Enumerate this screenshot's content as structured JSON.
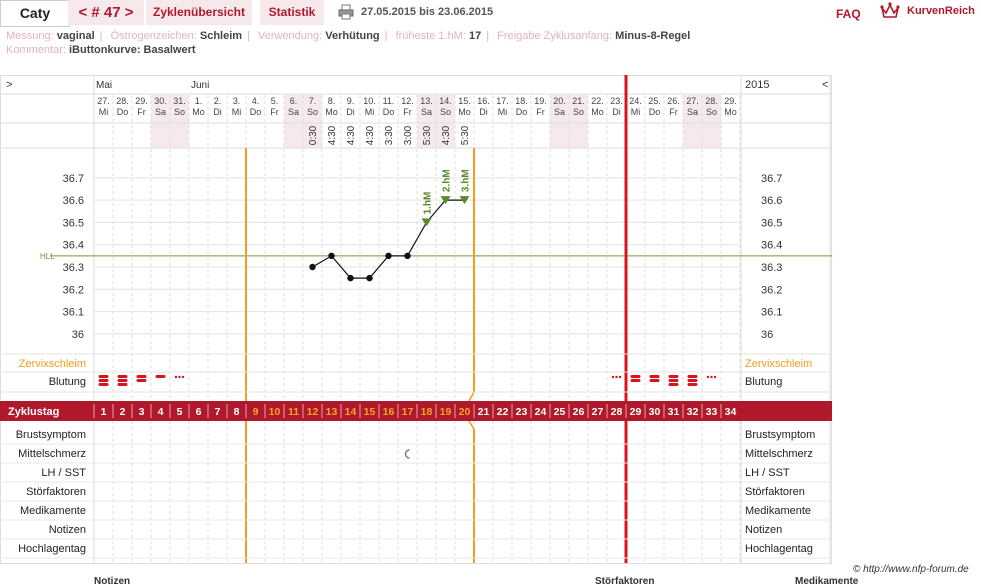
{
  "header": {
    "user_name": "Caty",
    "cycle_nav_label": "< # 47 >",
    "tabs": [
      {
        "label": "Zyklenübersicht"
      },
      {
        "label": "Statistik"
      }
    ],
    "print_icon": "printer-icon",
    "date_range": "27.05.2015 bis 23.06.2015",
    "faq_label": "FAQ",
    "brand_icon": "crown-icon",
    "brand_name": "KurvenReich"
  },
  "info": {
    "messung_label": "Messung:",
    "messung_value": "vaginal",
    "oestrogen_label": "Östrogenzeichen:",
    "oestrogen_value": "Schleim",
    "verwendung_label": "Verwendung:",
    "verwendung_value": "Verhütung",
    "hm_label": "früheste 1.hM:",
    "hm_value": "17",
    "freigabe_label": "Freigabe Zyklusanfang:",
    "freigabe_value": "Minus-8-Regel",
    "kommentar_label": "Kommentar:",
    "kommentar_value": "iButtonkurve: Basalwert"
  },
  "colors": {
    "accent": "#b0182c",
    "orange": "#f39c1f",
    "green": "#5a8a2a",
    "weekend_shade": "#f6e9ec"
  },
  "chart_data": {
    "type": "line",
    "nav_left": ">",
    "nav_right": "<",
    "year": "2015",
    "months": [
      {
        "label": "Mai",
        "day_index": 0
      },
      {
        "label": "Juni",
        "day_index": 5
      }
    ],
    "dates": [
      "27.",
      "28.",
      "29.",
      "30.",
      "31.",
      "1.",
      "2.",
      "3.",
      "4.",
      "5.",
      "6.",
      "7.",
      "8.",
      "9.",
      "10.",
      "11.",
      "12.",
      "13.",
      "14.",
      "15.",
      "16.",
      "17.",
      "18.",
      "19.",
      "20.",
      "21.",
      "22.",
      "23.",
      "24.",
      "25.",
      "26.",
      "27.",
      "28.",
      "29."
    ],
    "weekdays": [
      "Mi",
      "Do",
      "Fr",
      "Sa",
      "So",
      "Mo",
      "Di",
      "Mi",
      "Do",
      "Fr",
      "Sa",
      "So",
      "Mo",
      "Di",
      "Mi",
      "Do",
      "Fr",
      "Sa",
      "So",
      "Mo",
      "Di",
      "Mi",
      "Do",
      "Fr",
      "Sa",
      "So",
      "Mo",
      "Di",
      "Mi",
      "Do",
      "Fr",
      "Sa",
      "So",
      "Mo"
    ],
    "weekend_days": [
      3,
      4,
      10,
      11,
      17,
      18,
      24,
      25,
      31,
      32
    ],
    "times": [
      "",
      "",
      "",
      "",
      "",
      "",
      "",
      "",
      "",
      "",
      "",
      "0:30",
      "4:30",
      "4:30",
      "4:30",
      "3:30",
      "3:00",
      "5:30",
      "4:30",
      "5:30",
      "",
      "",
      "",
      "",
      "",
      "",
      "",
      "",
      "",
      "",
      "",
      "",
      "",
      ""
    ],
    "cycle_days": [
      "1",
      "2",
      "3",
      "4",
      "5",
      "6",
      "7",
      "8",
      "9",
      "10",
      "11",
      "12",
      "13",
      "14",
      "15",
      "16",
      "17",
      "18",
      "19",
      "20",
      "21",
      "22",
      "23",
      "24",
      "25",
      "26",
      "27",
      "28",
      "29",
      "30",
      "31",
      "32",
      "33",
      "34"
    ],
    "fertile_window": [
      8,
      19
    ],
    "highlight_day_text": [
      8,
      9,
      10,
      11,
      12,
      13,
      14,
      15,
      16,
      17,
      18,
      19
    ],
    "cycle_end_after_index": 27,
    "ylim": [
      35.95,
      36.78
    ],
    "yticks": [
      "36.7",
      "36.6",
      "36.5",
      "36.4",
      "36.3",
      "36.2",
      "36.1",
      "36"
    ],
    "hll": 36.35,
    "hll_label": "HLL",
    "temperatures": [
      {
        "day_index": 11,
        "value": 36.3
      },
      {
        "day_index": 12,
        "value": 36.35
      },
      {
        "day_index": 13,
        "value": 36.25
      },
      {
        "day_index": 14,
        "value": 36.25
      },
      {
        "day_index": 15,
        "value": 36.35
      },
      {
        "day_index": 16,
        "value": 36.35
      },
      {
        "day_index": 17,
        "value": 36.5
      },
      {
        "day_index": 18,
        "value": 36.6
      },
      {
        "day_index": 19,
        "value": 36.6
      }
    ],
    "hm_markers": [
      {
        "day_index": 17,
        "label": "1.hM"
      },
      {
        "day_index": 18,
        "label": "2.hM"
      },
      {
        "day_index": 19,
        "label": "3.hM"
      }
    ],
    "zervix_label": "Zervixschleim",
    "blutung_label": "Blutung",
    "bleeding": [
      {
        "day_index": 0,
        "level": 3
      },
      {
        "day_index": 1,
        "level": 3
      },
      {
        "day_index": 2,
        "level": 2
      },
      {
        "day_index": 3,
        "level": 1
      },
      {
        "day_index": 4,
        "level": 0
      },
      {
        "day_index": 27,
        "level": 0
      },
      {
        "day_index": 28,
        "level": 2
      },
      {
        "day_index": 29,
        "level": 2
      },
      {
        "day_index": 30,
        "level": 3
      },
      {
        "day_index": 31,
        "level": 3
      },
      {
        "day_index": 32,
        "level": 0
      }
    ],
    "zyklustag_label": "Zyklustag",
    "bottom_rows": [
      "Brustsymptom",
      "Mittelschmerz",
      "LH / SST",
      "Störfaktoren",
      "Medikamente",
      "Notizen",
      "Hochlagentag"
    ],
    "mittelschmerz_day_index": 16
  },
  "footer": {
    "copyright": "© http://www.nfp-forum.de",
    "notizen_label": "Notizen",
    "stoerfaktoren_label": "Störfaktoren",
    "medikamente_label": "Medikamente"
  }
}
